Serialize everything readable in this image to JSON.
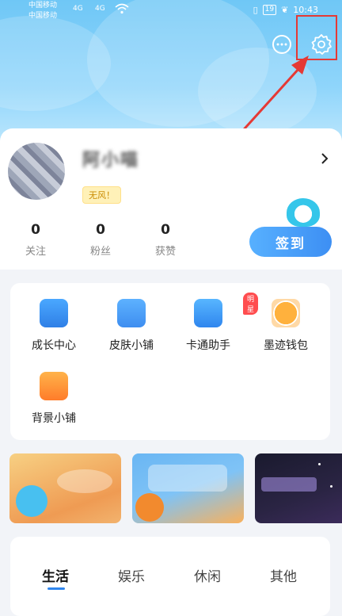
{
  "status_bar": {
    "carrier_1": "中国移动",
    "carrier_2": "中国移动",
    "signal_1": "4G",
    "signal_2": "4G",
    "battery": "19",
    "time": "10:43"
  },
  "profile": {
    "username": "阿小喵",
    "tag": "无风！",
    "stats": [
      {
        "value": "0",
        "label": "关注"
      },
      {
        "value": "0",
        "label": "粉丝"
      },
      {
        "value": "0",
        "label": "获赞"
      }
    ],
    "checkin_label": "签到"
  },
  "grid": {
    "items": [
      {
        "label": "成长中心",
        "icon": "store-icon"
      },
      {
        "label": "皮肤小铺",
        "icon": "document-icon"
      },
      {
        "label": "卡通助手",
        "icon": "cloud-face-icon",
        "badge": "明星"
      },
      {
        "label": "墨迹钱包",
        "icon": "pie-icon"
      },
      {
        "label": "背景小铺",
        "icon": "shop-icon"
      }
    ]
  },
  "tabs": [
    "生活",
    "娱乐",
    "休闲",
    "其他"
  ],
  "colors": {
    "accent": "#3d8ff3",
    "hero": "#6fc7f6",
    "highlight": "#e53935"
  }
}
